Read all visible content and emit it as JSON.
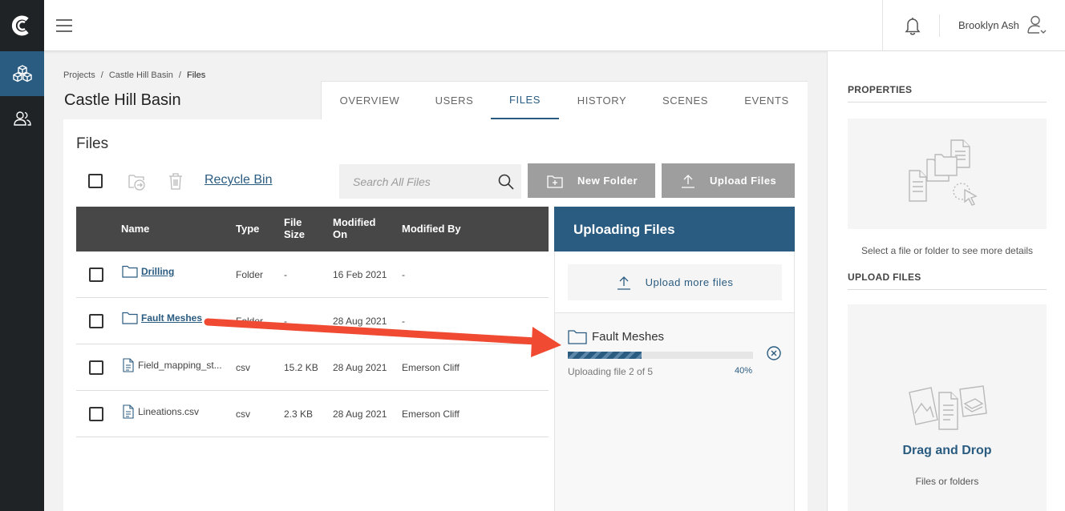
{
  "user": {
    "name": "Brooklyn Ash"
  },
  "breadcrumb": [
    "Projects",
    "Castle Hill Basin",
    "Files"
  ],
  "page_title": "Castle Hill Basin",
  "tabs": [
    {
      "label": "OVERVIEW",
      "active": false
    },
    {
      "label": "USERS",
      "active": false
    },
    {
      "label": "FILES",
      "active": true
    },
    {
      "label": "HISTORY",
      "active": false
    },
    {
      "label": "SCENES",
      "active": false
    },
    {
      "label": "EVENTS",
      "active": false
    }
  ],
  "files_panel": {
    "title": "Files",
    "recycle_bin": "Recycle Bin",
    "search_placeholder": "Search All Files",
    "new_folder": "New Folder",
    "upload_files": "Upload Files",
    "columns": {
      "name": "Name",
      "type": "Type",
      "size_line1": "File",
      "size_line2": "Size",
      "modified_line1": "Modified",
      "modified_line2": "On",
      "modified_by": "Modified By"
    },
    "rows": [
      {
        "name": "Drilling",
        "type": "Folder",
        "size": "-",
        "modified_on": "16 Feb 2021",
        "modified_by": "-",
        "kind": "folder"
      },
      {
        "name": "Fault Meshes",
        "type": "Folder",
        "size": "-",
        "modified_on": "28 Aug 2021",
        "modified_by": "-",
        "kind": "folder"
      },
      {
        "name": "Field_mapping_st...",
        "type": "csv",
        "size": "15.2 KB",
        "modified_on": "28 Aug 2021",
        "modified_by": "Emerson Cliff",
        "kind": "file"
      },
      {
        "name": "Lineations.csv",
        "type": "csv",
        "size": "2.3 KB",
        "modified_on": "28 Aug 2021",
        "modified_by": "Emerson Cliff",
        "kind": "file"
      }
    ]
  },
  "uploading": {
    "title": "Uploading Files",
    "upload_more": "Upload more files",
    "item": {
      "name": "Fault Meshes",
      "status": "Uploading file 2 of 5",
      "percent_label": "40%",
      "progress": 0.4
    }
  },
  "properties": {
    "title": "PROPERTIES",
    "placeholder": "Select a file or folder to see more details",
    "upload_title": "UPLOAD FILES",
    "drop_title": "Drag and Drop",
    "drop_sub": "Files or folders"
  },
  "colors": {
    "primary": "#2a5b80",
    "rail": "#1f2326",
    "header": "#474747",
    "button": "#9e9e9e",
    "annotation": "#f04a32"
  }
}
